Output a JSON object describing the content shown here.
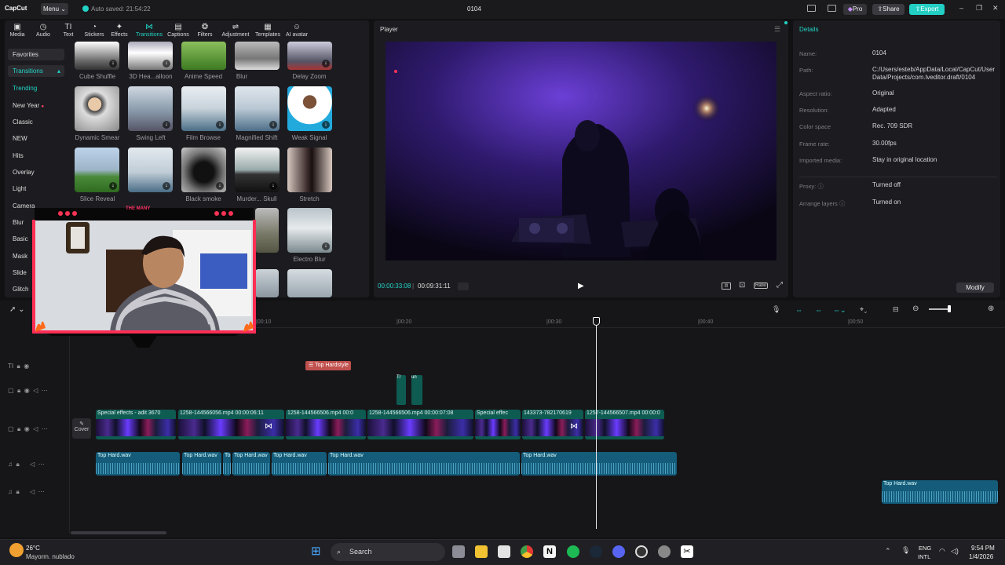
{
  "app": {
    "logo": "CapCut",
    "menu": "Menu",
    "autosave": "Auto saved: 21:54:22",
    "project_title": "0104",
    "pro": "Pro",
    "share": "Share",
    "export": "Export"
  },
  "toptabs": [
    {
      "label": "Media",
      "icon": "media-icon"
    },
    {
      "label": "Audio",
      "icon": "audio-icon"
    },
    {
      "label": "Text",
      "icon": "text-icon"
    },
    {
      "label": "Stickers",
      "icon": "sticker-icon"
    },
    {
      "label": "Effects",
      "icon": "effects-icon"
    },
    {
      "label": "Transitions",
      "icon": "transitions-icon"
    },
    {
      "label": "Captions",
      "icon": "captions-icon"
    },
    {
      "label": "Filters",
      "icon": "filters-icon"
    },
    {
      "label": "Adjustment",
      "icon": "adjustment-icon"
    },
    {
      "label": "Templates",
      "icon": "templates-icon"
    },
    {
      "label": "AI avatar",
      "icon": "ai-avatar-icon"
    }
  ],
  "sidebar": {
    "favorites": "Favorites",
    "transitions": "Transitions",
    "categories": [
      "Trending",
      "New Year",
      "Classic",
      "NEW",
      "Hits",
      "Overlay",
      "Light",
      "Camera",
      "Blur",
      "Basic",
      "Mask",
      "Slide",
      "Glitch"
    ]
  },
  "thumbs": {
    "row0": [
      "Cube Shuffle",
      "3D Hea...alloon",
      "Anime Speed",
      "Blur",
      "Delay Zoom"
    ],
    "row1": [
      "Dynamic Smear",
      "Swing Left",
      "Film Browse",
      "Magnified Shift",
      "Weak Signal"
    ],
    "row2": [
      "Slice Reveal",
      "",
      "Black smoke",
      "Murder... Skull",
      "Stretch"
    ],
    "row3": [
      "",
      "",
      "",
      "",
      "Electro Blur"
    ]
  },
  "player": {
    "title": "Player",
    "current_time": "00:00:33:08",
    "total_time": "00:09:31:11",
    "ratio": "Ratio"
  },
  "details": {
    "title": "Details",
    "rows": [
      {
        "label": "Name:",
        "value": "0104"
      },
      {
        "label": "Path:",
        "value": "C:/Users/esteb/AppData/Local/CapCut/User Data/Projects/com.lveditor.draft/0104"
      },
      {
        "label": "Aspect ratio:",
        "value": "Original"
      },
      {
        "label": "Resolution:",
        "value": "Adapted"
      },
      {
        "label": "Color space",
        "value": "Rec. 709 SDR"
      },
      {
        "label": "Frame rate:",
        "value": "30.00fps"
      },
      {
        "label": "Imported media:",
        "value": "Stay in original location"
      },
      {
        "label": "Proxy:",
        "value": "Turned off"
      },
      {
        "label": "Arrange layers",
        "value": "Turned on"
      }
    ],
    "modify": "Modify"
  },
  "timeline": {
    "ruler": [
      "|00:10",
      "|00:20",
      "|00:30",
      "|00:40",
      "|00:50"
    ],
    "text_clip": "Top Hardstyle",
    "cover": "Cover",
    "video_clips": [
      "Special effects - adit   3670",
      "1258-144566056.mp4   00:00:06:11",
      "1258-144566506.mp4   00:0",
      "1258-144566506.mp4   00:00:07:08",
      "Special effec",
      "143373-782170619",
      "1257-144566507.mp4   00:00:0"
    ],
    "audio_clips": [
      "Top Hard.wav",
      "Top Hard.wav",
      "To",
      "Top Hard.wav",
      "Top Hard.wav",
      "Top Hard.wav",
      "Top Hard.wav"
    ],
    "audio_clip_2": "Top Hard.wav",
    "overlay_clip_labels": [
      "T/",
      "un"
    ]
  },
  "webcam": {
    "banner": "THE MANY"
  },
  "taskbar": {
    "temperature": "26°C",
    "weather": "Mayorm. nublado",
    "search": "Search",
    "lang1": "ENG",
    "lang2": "INTL",
    "time": "9:54 PM",
    "date": "1/4/2026"
  },
  "colors": {
    "accent": "#22d3c5",
    "export": "#22cfc3",
    "text_clip": "#c0504d",
    "video_track": "#0e5b52",
    "audio_track": "#145c7a"
  }
}
